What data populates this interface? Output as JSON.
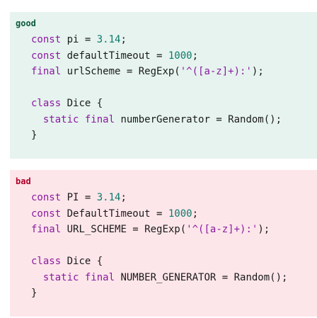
{
  "good": {
    "label": "good",
    "lines": [
      [
        {
          "t": "kw",
          "v": "const"
        },
        {
          "t": "id",
          "v": " pi = "
        },
        {
          "t": "num",
          "v": "3.14"
        },
        {
          "t": "id",
          "v": ";"
        }
      ],
      [
        {
          "t": "kw",
          "v": "const"
        },
        {
          "t": "id",
          "v": " defaultTimeout = "
        },
        {
          "t": "num",
          "v": "1000"
        },
        {
          "t": "id",
          "v": ";"
        }
      ],
      [
        {
          "t": "kw",
          "v": "final"
        },
        {
          "t": "id",
          "v": " urlScheme = RegExp("
        },
        {
          "t": "str",
          "v": "'^([a-z]+):'"
        },
        {
          "t": "id",
          "v": ");"
        }
      ],
      [],
      [
        {
          "t": "kw",
          "v": "class"
        },
        {
          "t": "id",
          "v": " Dice {"
        }
      ],
      [
        {
          "t": "id",
          "v": "  "
        },
        {
          "t": "kw",
          "v": "static final"
        },
        {
          "t": "id",
          "v": " numberGenerator = Random();"
        }
      ],
      [
        {
          "t": "id",
          "v": "}"
        }
      ]
    ]
  },
  "bad": {
    "label": "bad",
    "lines": [
      [
        {
          "t": "kw",
          "v": "const"
        },
        {
          "t": "id",
          "v": " PI = "
        },
        {
          "t": "num",
          "v": "3.14"
        },
        {
          "t": "id",
          "v": ";"
        }
      ],
      [
        {
          "t": "kw",
          "v": "const"
        },
        {
          "t": "id",
          "v": " DefaultTimeout = "
        },
        {
          "t": "num",
          "v": "1000"
        },
        {
          "t": "id",
          "v": ";"
        }
      ],
      [
        {
          "t": "kw",
          "v": "final"
        },
        {
          "t": "id",
          "v": " URL_SCHEME = RegExp("
        },
        {
          "t": "str",
          "v": "'^([a-z]+):'"
        },
        {
          "t": "id",
          "v": ");"
        }
      ],
      [],
      [
        {
          "t": "kw",
          "v": "class"
        },
        {
          "t": "id",
          "v": " Dice {"
        }
      ],
      [
        {
          "t": "id",
          "v": "  "
        },
        {
          "t": "kw",
          "v": "static final"
        },
        {
          "t": "id",
          "v": " NUMBER_GENERATOR = Random();"
        }
      ],
      [
        {
          "t": "id",
          "v": "}"
        }
      ]
    ]
  },
  "colors": {
    "good_bg": "#e6f3ef",
    "bad_bg": "#fde6ea",
    "good_label": "#0b5a3a",
    "bad_label": "#b0002a",
    "keyword": "#8a1a9e",
    "number": "#0b7a6a"
  }
}
